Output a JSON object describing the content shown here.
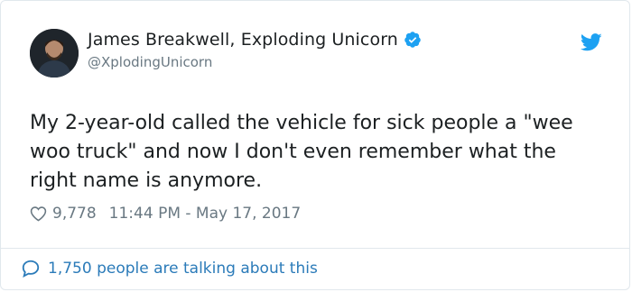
{
  "tweet": {
    "author": {
      "display_name": "James Breakwell, Exploding Unicorn",
      "handle": "@XplodingUnicorn",
      "verified": true,
      "avatar_icon": "user-avatar"
    },
    "text": "My 2-year-old called the vehicle for sick people a \"wee woo truck\" and now I don't even remember what the right name is anymore.",
    "likes": "9,778",
    "timestamp": "11:44 PM - May 17, 2017",
    "conversation_link": "1,750 people are talking about this"
  },
  "icons": {
    "verified": "verified-badge-icon",
    "brand": "twitter-bird-icon",
    "like": "heart-icon",
    "reply": "speech-bubble-icon"
  },
  "colors": {
    "brand_blue": "#1da1f2",
    "link_blue": "#2b7bb9",
    "muted_gray": "#697882",
    "text": "#1c2022",
    "border": "#e1e8ed"
  }
}
